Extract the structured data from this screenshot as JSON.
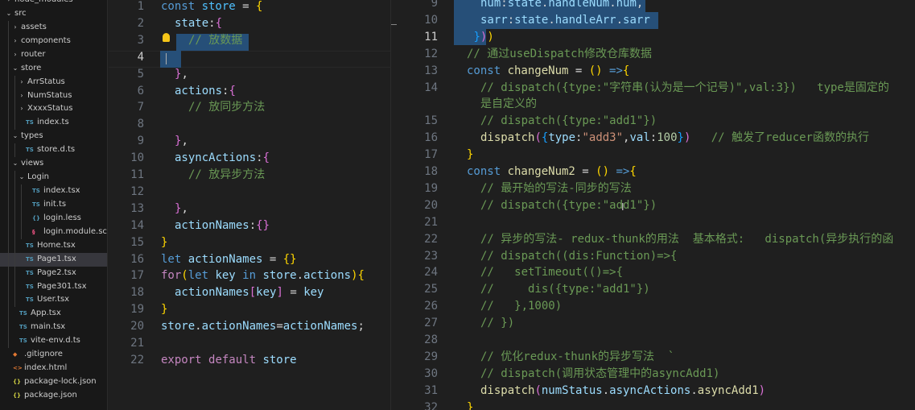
{
  "explorer": {
    "items": [
      {
        "label": "node_modules",
        "depth": 0,
        "kind": "folder",
        "open": false
      },
      {
        "label": "src",
        "depth": 0,
        "kind": "folder",
        "open": true
      },
      {
        "label": "assets",
        "depth": 1,
        "kind": "folder",
        "open": false
      },
      {
        "label": "components",
        "depth": 1,
        "kind": "folder",
        "open": false
      },
      {
        "label": "router",
        "depth": 1,
        "kind": "folder",
        "open": false
      },
      {
        "label": "store",
        "depth": 1,
        "kind": "folder",
        "open": true
      },
      {
        "label": "ArrStatus",
        "depth": 2,
        "kind": "folder",
        "open": false
      },
      {
        "label": "NumStatus",
        "depth": 2,
        "kind": "folder",
        "open": false
      },
      {
        "label": "XxxxStatus",
        "depth": 2,
        "kind": "folder",
        "open": false
      },
      {
        "label": "index.ts",
        "depth": 2,
        "kind": "ts",
        "icon": "TS"
      },
      {
        "label": "types",
        "depth": 1,
        "kind": "folder",
        "open": true
      },
      {
        "label": "store.d.ts",
        "depth": 2,
        "kind": "ts",
        "icon": "TS"
      },
      {
        "label": "views",
        "depth": 1,
        "kind": "folder",
        "open": true
      },
      {
        "label": "Login",
        "depth": 2,
        "kind": "folder",
        "open": true
      },
      {
        "label": "index.tsx",
        "depth": 3,
        "kind": "ts",
        "icon": "TS"
      },
      {
        "label": "init.ts",
        "depth": 3,
        "kind": "ts",
        "icon": "TS"
      },
      {
        "label": "login.less",
        "depth": 3,
        "kind": "less",
        "icon": "{}"
      },
      {
        "label": "login.module.scss",
        "depth": 3,
        "kind": "scss",
        "icon": "§"
      },
      {
        "label": "Home.tsx",
        "depth": 2,
        "kind": "ts",
        "icon": "TS"
      },
      {
        "label": "Page1.tsx",
        "depth": 2,
        "kind": "ts",
        "icon": "TS",
        "active": true
      },
      {
        "label": "Page2.tsx",
        "depth": 2,
        "kind": "ts",
        "icon": "TS"
      },
      {
        "label": "Page301.tsx",
        "depth": 2,
        "kind": "ts",
        "icon": "TS"
      },
      {
        "label": "User.tsx",
        "depth": 2,
        "kind": "ts",
        "icon": "TS"
      },
      {
        "label": "App.tsx",
        "depth": 1,
        "kind": "ts",
        "icon": "TS"
      },
      {
        "label": "main.tsx",
        "depth": 1,
        "kind": "ts",
        "icon": "TS"
      },
      {
        "label": "vite-env.d.ts",
        "depth": 1,
        "kind": "ts",
        "icon": "TS"
      },
      {
        "label": ".gitignore",
        "depth": 0,
        "kind": "git",
        "icon": "◆"
      },
      {
        "label": "index.html",
        "depth": 0,
        "kind": "html",
        "icon": "<>"
      },
      {
        "label": "package-lock.json",
        "depth": 0,
        "kind": "json",
        "icon": "{}"
      },
      {
        "label": "package.json",
        "depth": 0,
        "kind": "json",
        "icon": "{}"
      }
    ]
  },
  "editor_left": {
    "current_line": 4,
    "lines": [
      {
        "n": 1,
        "ind": 0,
        "t": [
          [
            "kw",
            "const "
          ],
          [
            "cst",
            "store"
          ],
          [
            "pl",
            " = "
          ],
          [
            "br1",
            "{"
          ]
        ]
      },
      {
        "n": 2,
        "ind": 1,
        "t": [
          [
            "var",
            "state"
          ],
          [
            "pl",
            ":"
          ],
          [
            "br2",
            "{"
          ]
        ]
      },
      {
        "n": 3,
        "ind": 2,
        "t": [
          [
            "cmt",
            "// 放数据"
          ]
        ]
      },
      {
        "n": 4,
        "ind": 0,
        "t": []
      },
      {
        "n": 5,
        "ind": 1,
        "t": [
          [
            "br2",
            "}"
          ],
          [
            "pl",
            ","
          ]
        ]
      },
      {
        "n": 6,
        "ind": 1,
        "t": [
          [
            "var",
            "actions"
          ],
          [
            "pl",
            ":"
          ],
          [
            "br2",
            "{"
          ]
        ]
      },
      {
        "n": 7,
        "ind": 2,
        "t": [
          [
            "cmt",
            "// 放同步方法"
          ]
        ]
      },
      {
        "n": 8,
        "ind": 0,
        "t": []
      },
      {
        "n": 9,
        "ind": 1,
        "t": [
          [
            "br2",
            "}"
          ],
          [
            "pl",
            ","
          ]
        ]
      },
      {
        "n": 10,
        "ind": 1,
        "t": [
          [
            "var",
            "asyncActions"
          ],
          [
            "pl",
            ":"
          ],
          [
            "br2",
            "{"
          ]
        ]
      },
      {
        "n": 11,
        "ind": 2,
        "t": [
          [
            "cmt",
            "// 放异步方法"
          ]
        ]
      },
      {
        "n": 12,
        "ind": 0,
        "t": []
      },
      {
        "n": 13,
        "ind": 1,
        "t": [
          [
            "br2",
            "}"
          ],
          [
            "pl",
            ","
          ]
        ]
      },
      {
        "n": 14,
        "ind": 1,
        "t": [
          [
            "var",
            "actionNames"
          ],
          [
            "pl",
            ":"
          ],
          [
            "br2",
            "{}"
          ]
        ]
      },
      {
        "n": 15,
        "ind": 0,
        "t": [
          [
            "br1",
            "}"
          ]
        ]
      },
      {
        "n": 16,
        "ind": 0,
        "t": [
          [
            "kw",
            "let "
          ],
          [
            "var",
            "actionNames"
          ],
          [
            "pl",
            " = "
          ],
          [
            "br1",
            "{}"
          ]
        ]
      },
      {
        "n": 17,
        "ind": 0,
        "t": [
          [
            "ctl",
            "for"
          ],
          [
            "br1",
            "("
          ],
          [
            "kw",
            "let "
          ],
          [
            "var",
            "key"
          ],
          [
            "kw",
            " in "
          ],
          [
            "var",
            "store"
          ],
          [
            "pl",
            "."
          ],
          [
            "var",
            "actions"
          ],
          [
            "br1",
            ")"
          ],
          [
            "br1",
            "{"
          ]
        ]
      },
      {
        "n": 18,
        "ind": 1,
        "t": [
          [
            "var",
            "actionNames"
          ],
          [
            "br2",
            "["
          ],
          [
            "var",
            "key"
          ],
          [
            "br2",
            "]"
          ],
          [
            "pl",
            " = "
          ],
          [
            "var",
            "key"
          ]
        ]
      },
      {
        "n": 19,
        "ind": 0,
        "t": [
          [
            "br1",
            "}"
          ]
        ]
      },
      {
        "n": 20,
        "ind": 0,
        "t": [
          [
            "var",
            "store"
          ],
          [
            "pl",
            "."
          ],
          [
            "var",
            "actionNames"
          ],
          [
            "pl",
            "="
          ],
          [
            "var",
            "actionNames"
          ],
          [
            "pl",
            ";"
          ]
        ]
      },
      {
        "n": 21,
        "ind": 0,
        "t": []
      },
      {
        "n": 22,
        "ind": 0,
        "t": [
          [
            "ctl",
            "export "
          ],
          [
            "ctl",
            "default "
          ],
          [
            "var",
            "store"
          ]
        ]
      }
    ]
  },
  "editor_right": {
    "current_line": 11,
    "lines": [
      {
        "n": "9",
        "ind": 1,
        "t": [
          [
            "var",
            "num"
          ],
          [
            "pl",
            ":"
          ],
          [
            "var",
            "state"
          ],
          [
            "pl",
            "."
          ],
          [
            "var",
            "handleNum"
          ],
          [
            "pl",
            "."
          ],
          [
            "var",
            "num"
          ],
          [
            "pl",
            ","
          ]
        ]
      },
      {
        "n": "10",
        "ind": 1,
        "t": [
          [
            "var",
            "sarr"
          ],
          [
            "pl",
            ":"
          ],
          [
            "var",
            "state"
          ],
          [
            "pl",
            "."
          ],
          [
            "var",
            "handleArr"
          ],
          [
            "pl",
            "."
          ],
          [
            "var",
            "sarr"
          ]
        ]
      },
      {
        "n": "11",
        "ind": 0,
        "t": [
          [
            "pl",
            " "
          ],
          [
            "br3",
            "}"
          ],
          [
            "br2",
            ")"
          ],
          [
            "br1",
            ")"
          ]
        ]
      },
      {
        "n": "12",
        "ind": 0,
        "t": [
          [
            "cmt",
            "// 通过useDispatch修改仓库数据"
          ]
        ]
      },
      {
        "n": "13",
        "ind": 0,
        "t": [
          [
            "kw",
            "const "
          ],
          [
            "fn",
            "changeNum"
          ],
          [
            "pl",
            " = "
          ],
          [
            "br1",
            "()"
          ],
          [
            "pl",
            " "
          ],
          [
            "kw",
            "=>"
          ],
          [
            "br1",
            "{"
          ]
        ]
      },
      {
        "n": "14",
        "ind": 1,
        "t": [
          [
            "cmt",
            "// dispatch({type:\"字符串(认为是一个记号)\",val:3})   type是固定的"
          ]
        ]
      },
      {
        "n": "",
        "ind": 1,
        "t": [
          [
            "cmt",
            "是自定义的"
          ]
        ],
        "wrap": true
      },
      {
        "n": "15",
        "ind": 1,
        "t": [
          [
            "cmt",
            "// dispatch({type:\"add1\"})"
          ]
        ]
      },
      {
        "n": "16",
        "ind": 1,
        "t": [
          [
            "fn",
            "dispatch"
          ],
          [
            "br2",
            "("
          ],
          [
            "br3",
            "{"
          ],
          [
            "var",
            "type"
          ],
          [
            "pl",
            ":"
          ],
          [
            "str",
            "\"add3\""
          ],
          [
            "pl",
            ","
          ],
          [
            "var",
            "val"
          ],
          [
            "pl",
            ":"
          ],
          [
            "num",
            "100"
          ],
          [
            "br3",
            "}"
          ],
          [
            "br2",
            ")"
          ],
          [
            "pl",
            "   "
          ],
          [
            "cmt",
            "// 触发了reducer函数的执行"
          ]
        ]
      },
      {
        "n": "17",
        "ind": 0,
        "t": [
          [
            "br1",
            "}"
          ]
        ]
      },
      {
        "n": "18",
        "ind": 0,
        "t": [
          [
            "kw",
            "const "
          ],
          [
            "fn",
            "changeNum2"
          ],
          [
            "pl",
            " = "
          ],
          [
            "br1",
            "()"
          ],
          [
            "pl",
            " "
          ],
          [
            "kw",
            "=>"
          ],
          [
            "br1",
            "{"
          ]
        ]
      },
      {
        "n": "19",
        "ind": 1,
        "t": [
          [
            "cmt",
            "// 最开始的写法-同步的写法"
          ]
        ]
      },
      {
        "n": "20",
        "ind": 1,
        "t": [
          [
            "cmt",
            "// dispatch({type:\"add1\"})"
          ]
        ]
      },
      {
        "n": "21",
        "ind": 0,
        "t": []
      },
      {
        "n": "22",
        "ind": 1,
        "t": [
          [
            "cmt",
            "// 异步的写法- redux-thunk的用法  基本格式:   dispatch(异步执行的函"
          ]
        ]
      },
      {
        "n": "23",
        "ind": 1,
        "t": [
          [
            "cmt",
            "// dispatch((dis:Function)=>{"
          ]
        ]
      },
      {
        "n": "24",
        "ind": 1,
        "t": [
          [
            "cmt",
            "//   setTimeout(()=>{"
          ]
        ]
      },
      {
        "n": "25",
        "ind": 1,
        "t": [
          [
            "cmt",
            "//     dis({type:\"add1\"})"
          ]
        ]
      },
      {
        "n": "26",
        "ind": 1,
        "t": [
          [
            "cmt",
            "//   },1000)"
          ]
        ]
      },
      {
        "n": "27",
        "ind": 1,
        "t": [
          [
            "cmt",
            "// })"
          ]
        ]
      },
      {
        "n": "28",
        "ind": 0,
        "t": []
      },
      {
        "n": "29",
        "ind": 1,
        "t": [
          [
            "cmt",
            "// 优化redux-thunk的异步写法  `"
          ]
        ]
      },
      {
        "n": "30",
        "ind": 1,
        "t": [
          [
            "cmt",
            "// dispatch(调用状态管理中的asyncAdd1)"
          ]
        ]
      },
      {
        "n": "31",
        "ind": 1,
        "t": [
          [
            "fn",
            "dispatch"
          ],
          [
            "br2",
            "("
          ],
          [
            "var",
            "numStatus"
          ],
          [
            "pl",
            "."
          ],
          [
            "var",
            "asyncActions"
          ],
          [
            "pl",
            "."
          ],
          [
            "fn",
            "asyncAdd1"
          ],
          [
            "br2",
            ")"
          ]
        ]
      },
      {
        "n": "32",
        "ind": 0,
        "t": [
          [
            "br1",
            "}"
          ]
        ]
      }
    ]
  },
  "colors": {
    "background": "#1f1f1f",
    "sidebar": "#181818",
    "selection": "#264f78",
    "keyword": "#569cd6",
    "variable": "#9cdcfe",
    "function": "#dcdcaa",
    "string": "#ce9178",
    "number": "#b5cea8",
    "comment": "#6a9955",
    "ts_icon": "#519aba"
  }
}
